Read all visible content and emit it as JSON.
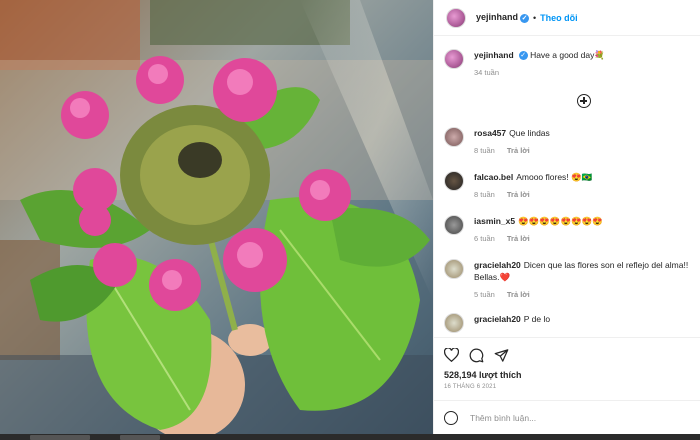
{
  "header": {
    "username": "yejinhand",
    "verified": true,
    "dot": "•",
    "follow_label": "Theo dõi"
  },
  "caption": {
    "username": "yejinhand",
    "text": "Have a good day💐",
    "time": "34 tuần"
  },
  "load_more_icon": "plus-circle-icon",
  "comments": [
    {
      "username": "rosa457",
      "text": "Que lindas",
      "time": "8 tuần",
      "reply": "Trả lời"
    },
    {
      "username": "falcao.bel",
      "text": "Amooo flores! 😍🇧🇷",
      "time": "8 tuần",
      "reply": "Trả lời"
    },
    {
      "username": "iasmin_x5",
      "text": "😍😍😍😍😍😍😍😍",
      "time": "6 tuần",
      "reply": "Trả lời"
    },
    {
      "username": "gracielah20",
      "text": "Dicen que las flores son el reflejo del alma!! Bellas.❤️",
      "time": "5 tuần",
      "reply": "Trả lời"
    },
    {
      "username": "gracielah20",
      "text": "P de lo",
      "time": "",
      "reply": ""
    }
  ],
  "actions": {
    "likes": "528,194 lượt thích",
    "date": "16 THÁNG 6 2021",
    "icons": [
      "heart-icon",
      "comment-icon",
      "share-icon"
    ]
  },
  "add_comment": {
    "placeholder": "Thêm bình luận..."
  },
  "colors": {
    "accent": "#0095f6",
    "verified": "#3897f0",
    "flower_pink": "#e0489a",
    "leaf_green": "#6fbf3a"
  }
}
